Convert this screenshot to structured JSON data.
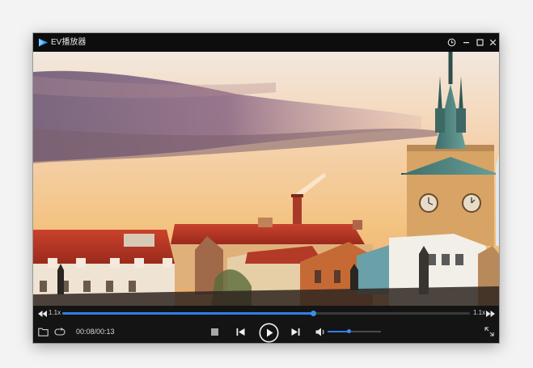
{
  "window": {
    "title": "EV播放器",
    "buttons": {
      "history_icon": "clock-icon",
      "minimize_icon": "minimize-icon",
      "maximize_icon": "maximize-icon",
      "close_icon": "close-icon"
    }
  },
  "playback": {
    "rewind_speed": "1.1x",
    "forward_speed": "1.1x",
    "progress": 0.615,
    "time_display": "00:08/00:13",
    "volume": 0.4
  },
  "colors": {
    "accent": "#2f7fe8",
    "chrome_bg": "#141414",
    "titlebar_bg": "#0d0d0d"
  },
  "icons": {
    "logo": "ev-logo-icon",
    "open_folder": "folder-icon",
    "loop": "loop-icon",
    "stop": "stop-icon",
    "previous": "skip-previous-icon",
    "play": "play-icon",
    "next": "skip-next-icon",
    "volume": "volume-icon",
    "fullscreen": "fullscreen-icon"
  }
}
